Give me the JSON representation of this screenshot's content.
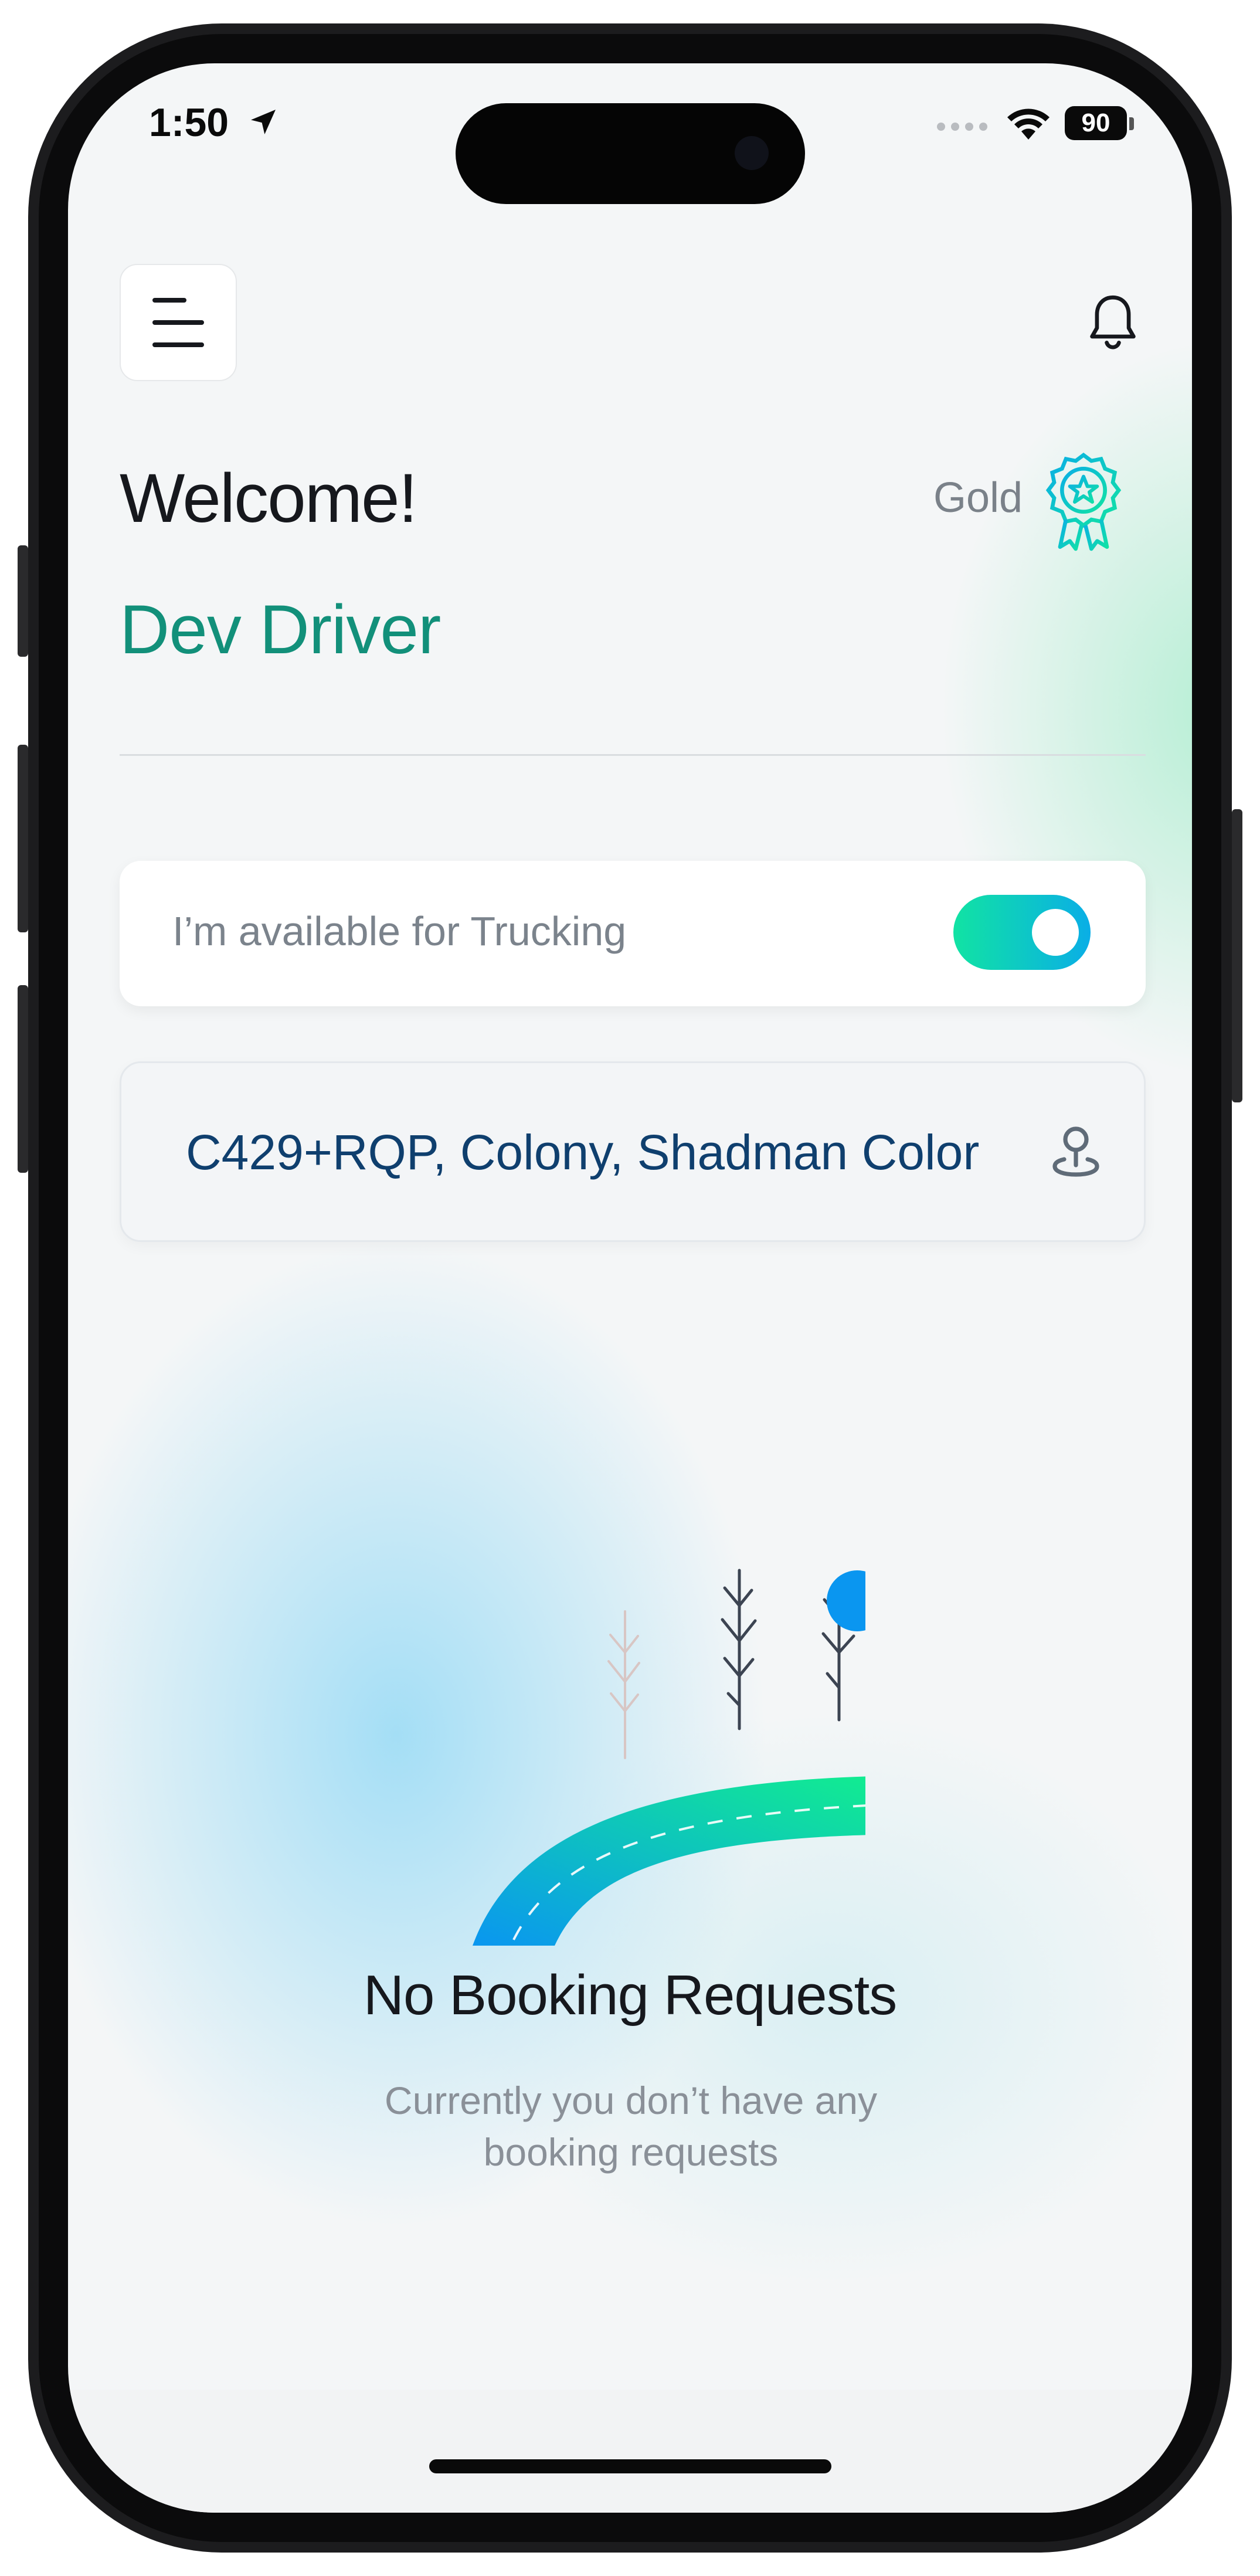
{
  "status_bar": {
    "time": "1:50",
    "battery": "90"
  },
  "header": {
    "menu_icon": "hamburger-menu-icon",
    "notification_icon": "bell-icon"
  },
  "greeting": {
    "welcome": "Welcome!",
    "driver_name": "Dev Driver",
    "tier": "Gold",
    "tier_icon": "badge-award-icon"
  },
  "availability": {
    "label": "I’m available for Trucking",
    "enabled": true
  },
  "location": {
    "address": "C429+RQP, Colony, Shadman Color",
    "icon": "map-pin-icon"
  },
  "empty_state": {
    "illustration": "road-trees-illustration",
    "title": "No Booking Requests",
    "subtitle": "Currently you don’t have any booking requests"
  },
  "colors": {
    "accent_green": "#12907a",
    "address_blue": "#0f3f6e",
    "toggle_start": "#11e3a3",
    "toggle_end": "#0aaee6"
  }
}
